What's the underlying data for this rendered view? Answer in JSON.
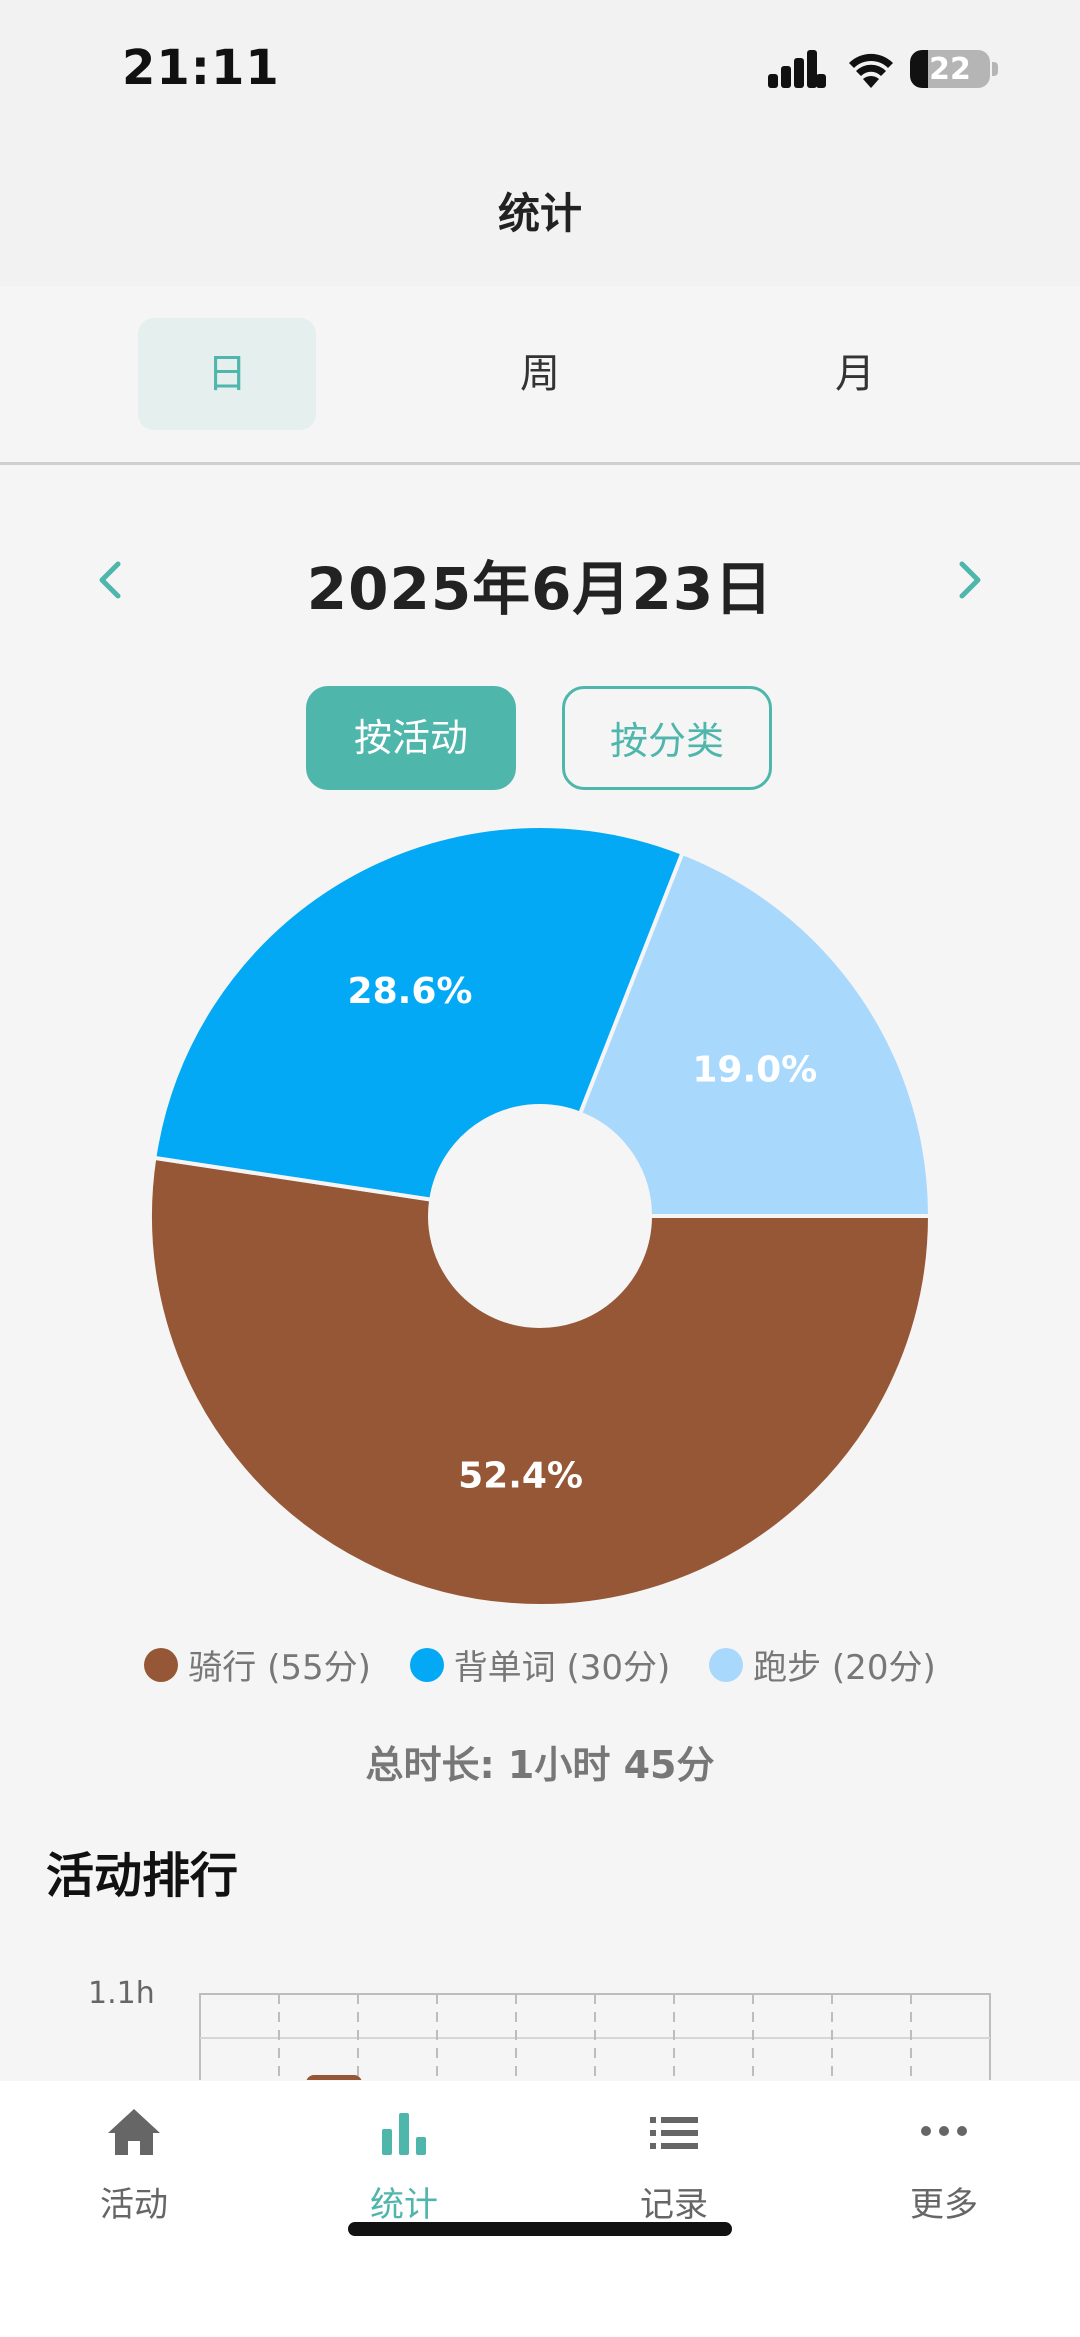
{
  "status_bar": {
    "time": "21:11",
    "battery_level": "22",
    "battery_fraction": 0.22
  },
  "header": {
    "title": "统计"
  },
  "period_tabs": [
    {
      "label": "日",
      "active": true
    },
    {
      "label": "周",
      "active": false
    },
    {
      "label": "月",
      "active": false
    }
  ],
  "date_nav": {
    "date": "2025年6月23日",
    "prev_icon": "chevron-left-icon",
    "next_icon": "chevron-right-icon"
  },
  "mode_toggle": {
    "by_activity": "按活动",
    "by_category": "按分类",
    "active": "by_activity"
  },
  "chart_data": {
    "type": "pie",
    "donut": true,
    "categories": [
      "骑行",
      "背单词",
      "跑步"
    ],
    "values": [
      55,
      30,
      20
    ],
    "percent_labels": [
      "52.4%",
      "28.6%",
      "19.0%"
    ],
    "colors": [
      "#955736",
      "#03a9f4",
      "#a9d8fd"
    ],
    "legend": [
      "骑行 (55分)",
      "背单词 (30分)",
      "跑步 (20分)"
    ],
    "legend_position": "bottom"
  },
  "total_duration": "总时长: 1小时 45分",
  "ranking": {
    "title": "活动排行",
    "y_tick_top": "1.1h",
    "bar_color": "#955736"
  },
  "bottom_nav": [
    {
      "label": "活动",
      "icon": "home-icon",
      "active": false
    },
    {
      "label": "统计",
      "icon": "bar-chart-icon",
      "active": true
    },
    {
      "label": "记录",
      "icon": "list-icon",
      "active": false
    },
    {
      "label": "更多",
      "icon": "more-dots-icon",
      "active": false
    }
  ],
  "colors": {
    "accent": "#4fb6ab",
    "background": "#f5f5f5",
    "header_bg": "#f2f2f2"
  }
}
